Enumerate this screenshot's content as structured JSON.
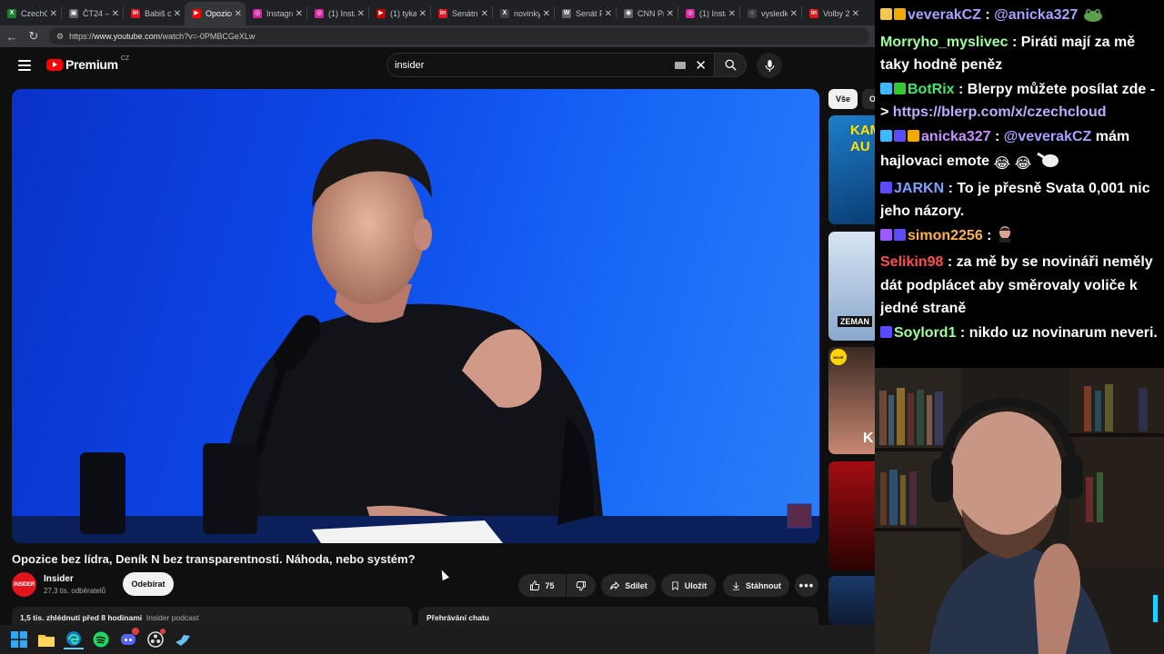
{
  "browser": {
    "tabs": [
      {
        "label": "CzechC",
        "color": "#1e7e34",
        "glyph": "X"
      },
      {
        "label": "ČT24 –",
        "color": "#5f6368",
        "glyph": "▣"
      },
      {
        "label": "Babiš c",
        "color": "#e1151b",
        "glyph": "in"
      },
      {
        "label": "Opozice",
        "color": "#ff0000",
        "glyph": "▶",
        "active": true
      },
      {
        "label": "Instagra",
        "color": "#d6249f",
        "glyph": "◎"
      },
      {
        "label": "(1) Insta",
        "color": "#d6249f",
        "glyph": "◎"
      },
      {
        "label": "(1) tyka",
        "color": "#cc0000",
        "glyph": "▶"
      },
      {
        "label": "Senátn",
        "color": "#e1151b",
        "glyph": "in"
      },
      {
        "label": "novinky",
        "color": "#3c4043",
        "glyph": "X"
      },
      {
        "label": "Senát P",
        "color": "#5f6368",
        "glyph": "W"
      },
      {
        "label": "CNN Pr",
        "color": "#5f6368",
        "glyph": "◉"
      },
      {
        "label": "(1) Insta",
        "color": "#d6249f",
        "glyph": "◎"
      },
      {
        "label": "vysledk",
        "color": "#3c4043",
        "glyph": "○"
      },
      {
        "label": "Volby 2",
        "color": "#e1151b",
        "glyph": "in"
      }
    ],
    "url_prefix": "https://",
    "url_host": "www.youtube.com",
    "url_path": "/watch?v=-0PMBCGeXLw"
  },
  "youtube": {
    "logo_text": "Premium",
    "logo_region": "CZ",
    "search_value": "insider",
    "video_title": "Opozice bez lídra, Deník N bez transparentnosti. Náhoda, nebo systém?",
    "channel": {
      "name": "Insider",
      "subscribers": "27,3 tis. odběratelů",
      "avatar_text": "INSIDER"
    },
    "subscribe_label": "Odebírat",
    "likes": "75",
    "share_label": "Sdílet",
    "save_label": "Uložit",
    "download_label": "Stáhnout",
    "description": {
      "views_time": "1,5 tis. zhlédnutí  před 8 hodinami",
      "link": "Insider podcast"
    },
    "chat_replay_label": "Přehrávání chatu",
    "chips": [
      "Vše",
      "O"
    ],
    "thumb_texts": [
      "KAM",
      "AU",
      "ZEMAN",
      "NOVÉ",
      "K"
    ]
  },
  "chat": {
    "messages": [
      {
        "user": "veverakCZ",
        "color": "#a9a0ff",
        "text": "@anicka327",
        "mention": true
      },
      {
        "user": "Morryho_myslivec",
        "color": "#9eff9e",
        "text": "Piráti mají za mě taky hodně peněz"
      },
      {
        "user": "BotRix",
        "color": "#3fe86b",
        "text": "Blerpy můžete posílat zde -> ",
        "link": "https://blerp.com/x/czechcloud"
      },
      {
        "user": "anicka327",
        "color": "#c792ff",
        "text": "@veverakCZ",
        "tail": " mám hajlovaci emote"
      },
      {
        "user": "JARKN",
        "color": "#7aa2ff",
        "text": "To je přesně Svata 0,001 nic jeho názory."
      },
      {
        "user": "simon2256",
        "color": "#ffb347",
        "text": ""
      },
      {
        "user": "Selikin98",
        "color": "#ff4d4d",
        "text": "za mě by se novináři neměly dát podplácet aby směrovaly voliče k jedné straně"
      },
      {
        "user": "Soylord1",
        "color": "#9eff9e",
        "text": "nikdo uz novinarum neveri."
      }
    ]
  }
}
